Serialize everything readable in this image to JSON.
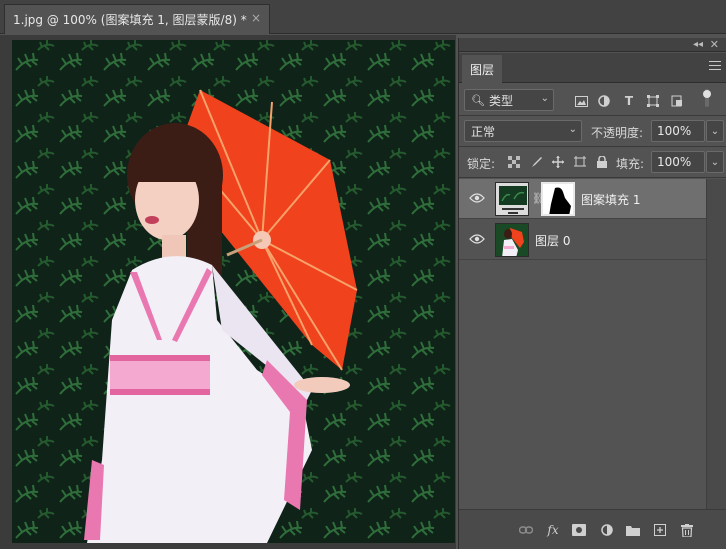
{
  "document": {
    "tab_title": "1.jpg @ 100% (图案填充 1, 图层蒙版/8) *",
    "close_glyph": "×"
  },
  "panel": {
    "tab_label": "图层",
    "filter": {
      "value": "类型",
      "icons": [
        "image-filter-icon",
        "adjustment-filter-icon",
        "type-filter-icon",
        "shape-filter-icon",
        "smart-object-filter-icon"
      ]
    },
    "blend_mode": "正常",
    "opacity_label": "不透明度:",
    "opacity_value": "100%",
    "lock_label": "锁定:",
    "fill_label": "填充:",
    "fill_value": "100%"
  },
  "layers": [
    {
      "name": "图案填充 1",
      "selected": true,
      "has_mask": true
    },
    {
      "name": "图层 0",
      "selected": false,
      "has_mask": false
    }
  ],
  "bottom_icons": [
    "link-layers-icon",
    "fx-icon",
    "add-mask-icon",
    "adjustment-layer-icon",
    "group-folder-icon",
    "new-layer-icon",
    "delete-icon"
  ],
  "fx_label": "fx",
  "colors": {
    "umbrella": "#f0421c",
    "foliage": "#1a4a25",
    "background_dark": "#0f2319",
    "panel": "#535353",
    "selected_layer": "#6f6f6f"
  }
}
